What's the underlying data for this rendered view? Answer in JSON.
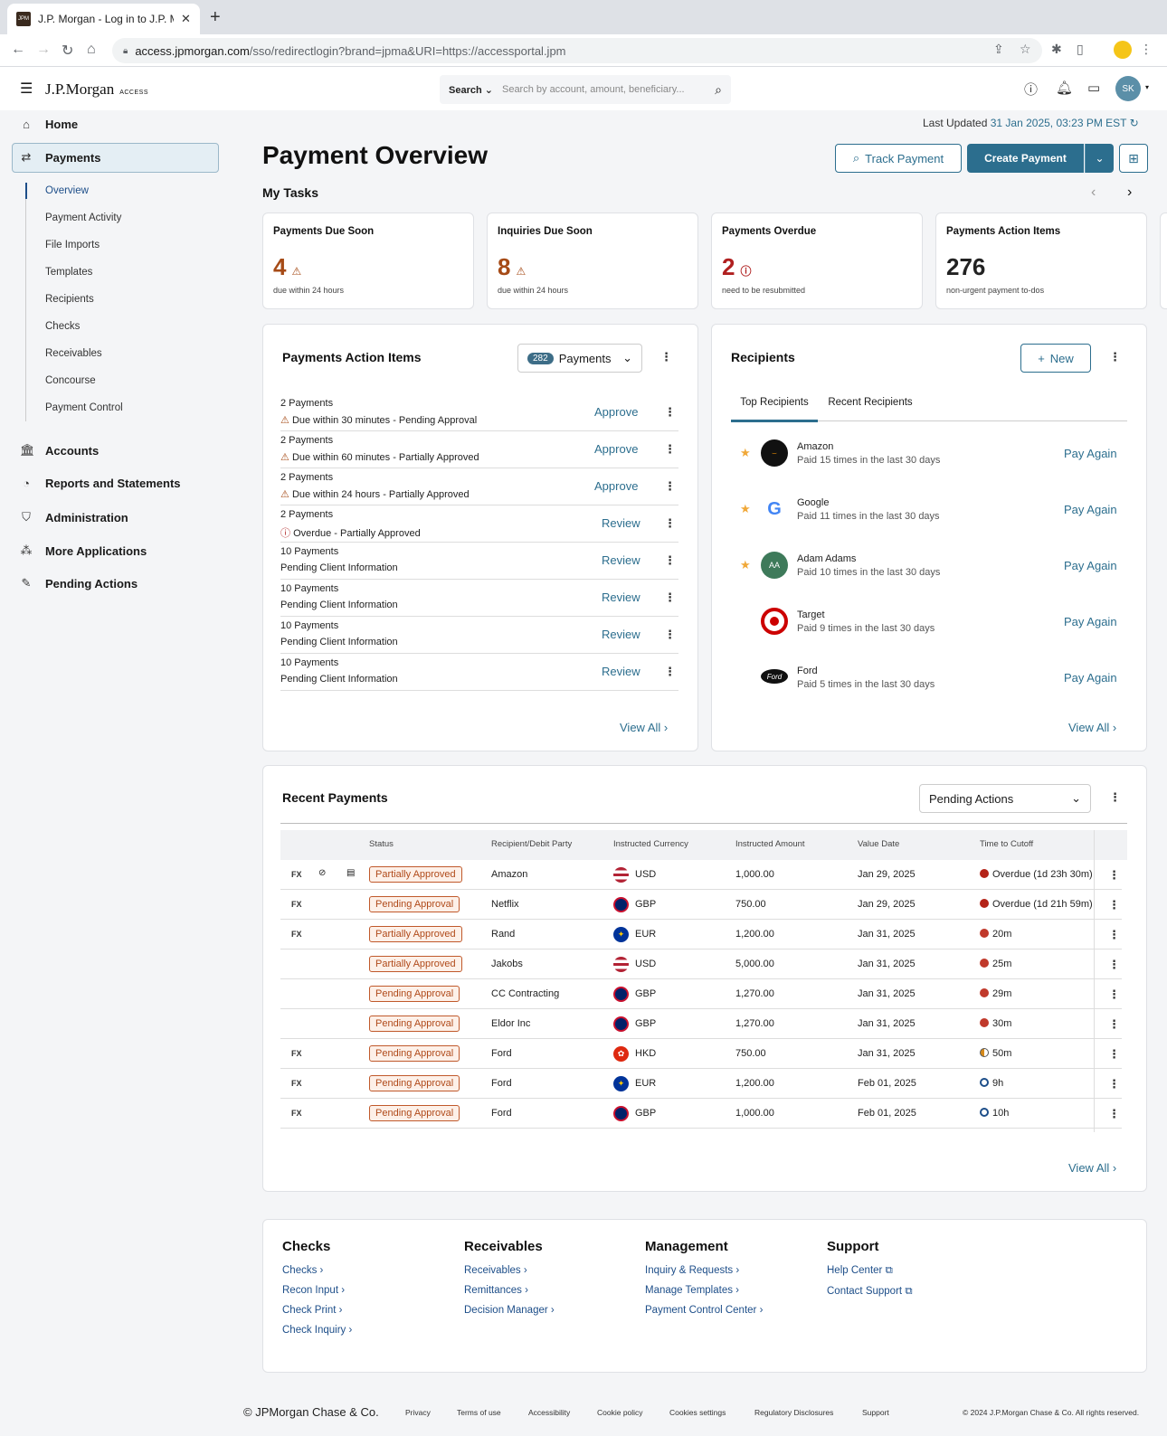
{
  "browser": {
    "tab_title": "J.P. Morgan - Log in to J.P. Mo",
    "url_host": "access.jpmorgan.com",
    "url_path": "/sso/redirectlogin?brand=jpma&URI=https://accessportal.jpm",
    "favicon_text": "JPM"
  },
  "header": {
    "logo": "J.P.Morgan",
    "logo_sub": "ACCESS",
    "search_label": "Search",
    "search_placeholder": "Search by account, amount, beneficiary...",
    "avatar": "SK"
  },
  "sidebar": {
    "home": "Home",
    "payments": "Payments",
    "sub": [
      "Overview",
      "Payment Activity",
      "File Imports",
      "Templates",
      "Recipients",
      "Checks",
      "Receivables",
      "Concourse",
      "Payment Control"
    ],
    "accounts": "Accounts",
    "reports": "Reports and Statements",
    "admin": "Administration",
    "more": "More Applications",
    "pending": "Pending Actions"
  },
  "page": {
    "title": "Payment Overview",
    "last_updated_label": "Last Updated",
    "last_updated_value": "31 Jan 2025, 03:23 PM EST",
    "track": "Track Payment",
    "create": "Create Payment"
  },
  "tasks": {
    "heading": "My Tasks",
    "cards": [
      {
        "title": "Payments Due Soon",
        "value": "4",
        "sub": "due within 24 hours"
      },
      {
        "title": "Inquiries Due Soon",
        "value": "8",
        "sub": "due within 24 hours"
      },
      {
        "title": "Payments Overdue",
        "value": "2",
        "sub": "need to be resubmitted"
      },
      {
        "title": "Payments Action Items",
        "value": "276",
        "sub": "non-urgent payment to-dos"
      }
    ]
  },
  "action_items": {
    "title": "Payments Action Items",
    "badge": "282",
    "dropdown": "Payments",
    "view_all": "View All",
    "rows": [
      {
        "l1": "2 Payments",
        "l2": "Due within 30 minutes - Pending Approval",
        "action": "Approve"
      },
      {
        "l1": "2 Payments",
        "l2": "Due within 60 minutes - Partially Approved",
        "action": "Approve"
      },
      {
        "l1": "2 Payments",
        "l2": "Due within 24 hours - Partially Approved",
        "action": "Approve"
      },
      {
        "l1": "2 Payments",
        "l2": "Overdue - Partially Approved",
        "action": "Review"
      },
      {
        "l1": "10 Payments",
        "l2": "Pending Client Information",
        "action": "Review"
      },
      {
        "l1": "10 Payments",
        "l2": "Pending Client Information",
        "action": "Review"
      },
      {
        "l1": "10 Payments",
        "l2": "Pending Client Information",
        "action": "Review"
      },
      {
        "l1": "10 Payments",
        "l2": "Pending Client Information",
        "action": "Review"
      }
    ]
  },
  "recipients": {
    "title": "Recipients",
    "new": "New",
    "tab1": "Top Recipients",
    "tab2": "Recent Recipients",
    "view_all": "View All",
    "rows": [
      {
        "name": "Amazon",
        "sub": "Paid 15 times in the last 30 days",
        "action": "Pay Again",
        "initials": ""
      },
      {
        "name": "Google",
        "sub": "Paid 11 times in the last 30 days",
        "action": "Pay Again",
        "initials": "G"
      },
      {
        "name": "Adam Adams",
        "sub": "Paid 10 times in the last 30 days",
        "action": "Pay Again",
        "initials": "AA"
      },
      {
        "name": "Target",
        "sub": "Paid 9 times in the last 30 days",
        "action": "Pay Again",
        "initials": ""
      },
      {
        "name": "Ford",
        "sub": "Paid 5 times in the last 30 days",
        "action": "Pay Again",
        "initials": "Ford"
      }
    ]
  },
  "recent": {
    "title": "Recent Payments",
    "filter": "Pending Actions",
    "view_all": "View All",
    "fx": "FX",
    "headers": [
      "Status",
      "Recipient/Debit Party",
      "Instructed Currency",
      "Instructed Amount",
      "Value Date",
      "Time to Cutoff"
    ],
    "rows": [
      {
        "status": "Partially Approved",
        "party": "Amazon",
        "ccy": "USD",
        "amt": "1,000.00",
        "date": "Jan 29, 2025",
        "cut": "Overdue (1d 23h 30m)"
      },
      {
        "status": "Pending Approval",
        "party": "Netflix",
        "ccy": "GBP",
        "amt": "750.00",
        "date": "Jan 29, 2025",
        "cut": "Overdue (1d 21h 59m)"
      },
      {
        "status": "Partially Approved",
        "party": "Rand",
        "ccy": "EUR",
        "amt": "1,200.00",
        "date": "Jan 31, 2025",
        "cut": "20m"
      },
      {
        "status": "Partially Approved",
        "party": "Jakobs",
        "ccy": "USD",
        "amt": "5,000.00",
        "date": "Jan 31, 2025",
        "cut": "25m"
      },
      {
        "status": "Pending Approval",
        "party": "CC Contracting",
        "ccy": "GBP",
        "amt": "1,270.00",
        "date": "Jan 31, 2025",
        "cut": "29m"
      },
      {
        "status": "Pending Approval",
        "party": "Eldor Inc",
        "ccy": "GBP",
        "amt": "1,270.00",
        "date": "Jan 31, 2025",
        "cut": "30m"
      },
      {
        "status": "Pending Approval",
        "party": "Ford",
        "ccy": "HKD",
        "amt": "750.00",
        "date": "Jan 31, 2025",
        "cut": "50m"
      },
      {
        "status": "Pending Approval",
        "party": "Ford",
        "ccy": "EUR",
        "amt": "1,200.00",
        "date": "Feb 01, 2025",
        "cut": "9h"
      },
      {
        "status": "Pending Approval",
        "party": "Ford",
        "ccy": "GBP",
        "amt": "1,000.00",
        "date": "Feb 01, 2025",
        "cut": "10h"
      }
    ]
  },
  "footer": {
    "cols": [
      {
        "h": "Checks",
        "links": [
          "Checks",
          "Recon Input",
          "Check Print",
          "Check Inquiry"
        ]
      },
      {
        "h": "Receivables",
        "links": [
          "Receivables",
          "Remittances",
          "Decision Manager"
        ]
      },
      {
        "h": "Management",
        "links": [
          "Inquiry & Requests",
          "Manage Templates",
          "Payment Control Center"
        ]
      },
      {
        "h": "Support",
        "links": [
          "Help Center",
          "Contact Support"
        ]
      }
    ],
    "copyright": "© JPMorgan Chase & Co.",
    "links": [
      "Privacy",
      "Terms of use",
      "Accessibility",
      "Cookie policy",
      "Cookies settings",
      "Regulatory Disclosures",
      "Support"
    ],
    "rights": "© 2024 J.P.Morgan Chase & Co.  All rights reserved."
  },
  "colors": {
    "accent": "#2c6e8e",
    "warn": "#a64b17",
    "danger": "#b02020",
    "overdue_dot": "#b42318"
  }
}
